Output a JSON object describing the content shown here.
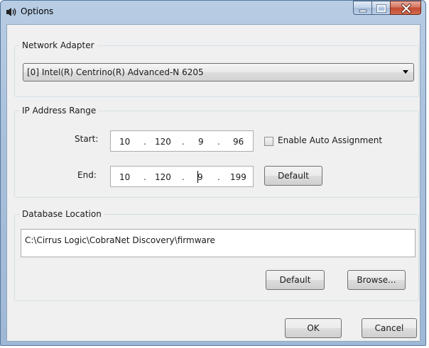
{
  "window": {
    "title": "Options",
    "icon": "speaker-icon",
    "caption_buttons": [
      "minimize-icon",
      "maximize-icon",
      "close-icon"
    ]
  },
  "network_adapter": {
    "group_label": "Network Adapter",
    "selected": "[0] Intel(R) Centrino(R) Advanced-N 6205"
  },
  "ip_range": {
    "group_label": "IP Address Range",
    "start_label": "Start:",
    "end_label": "End:",
    "separator": ".",
    "start": [
      "10",
      "120",
      "9",
      "96"
    ],
    "end": [
      "10",
      "120",
      "9",
      "199"
    ],
    "auto_assign_label": "Enable Auto Assignment",
    "auto_assign_checked": false,
    "default_label": "Default"
  },
  "database": {
    "group_label": "Database Location",
    "path": "C:\\Cirrus Logic\\CobraNet Discovery\\firmware",
    "default_label": "Default",
    "browse_label": "Browse..."
  },
  "footer": {
    "ok_label": "OK",
    "cancel_label": "Cancel"
  }
}
